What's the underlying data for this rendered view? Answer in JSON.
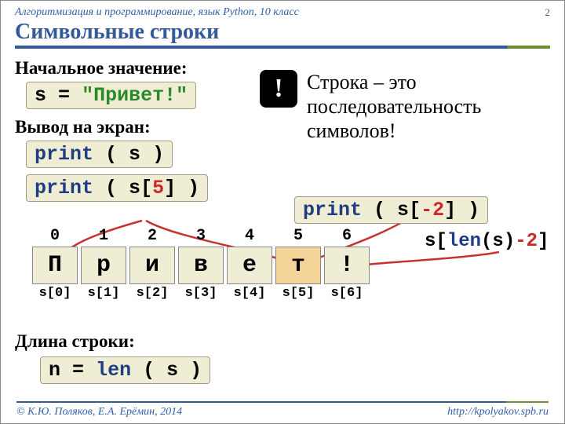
{
  "header": {
    "subject": "Алгоритмизация и программирование, язык Python, 10 класс",
    "page": "2"
  },
  "title": "Символьные строки",
  "initial": {
    "label": "Начальное значение:",
    "code_s": "s",
    "code_eq": "=",
    "code_lit": "\"Привет!\""
  },
  "callout": {
    "mark": "!",
    "text": "Строка – это последовательность символов!"
  },
  "print_section": {
    "label": "Вывод на экран:",
    "print": "print",
    "s": "s",
    "idx5": "5",
    "idx_neg2": "-2"
  },
  "len_expr": {
    "s": "s",
    "len": "len",
    "s2": "(s)",
    "minus2": "-2"
  },
  "chars": {
    "indices": [
      "0",
      "1",
      "2",
      "3",
      "4",
      "5",
      "6"
    ],
    "cells": [
      "П",
      "р",
      "и",
      "в",
      "е",
      "т",
      "!"
    ],
    "labels": [
      "s[0]",
      "s[1]",
      "s[2]",
      "s[3]",
      "s[4]",
      "s[5]",
      "s[6]"
    ]
  },
  "len_section": {
    "label": "Длина строки:",
    "n": "n",
    "eq": "=",
    "len": "len",
    "args": "( s )"
  },
  "footer": {
    "copy": "© К.Ю. Поляков, Е.А. Ерёмин, 2014",
    "url": "http://kpolyakov.spb.ru"
  }
}
